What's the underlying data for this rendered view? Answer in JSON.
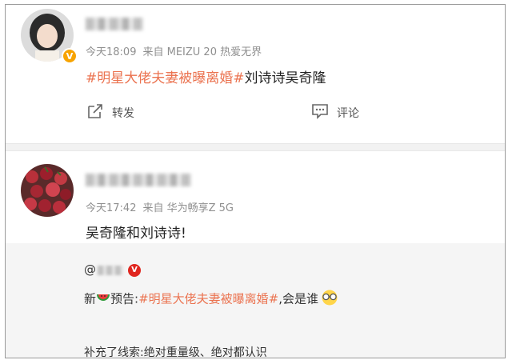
{
  "post1": {
    "time": "今天18:09",
    "source": "来自 MEIZU 20 热爱无界",
    "hashtag": "#明星大佬夫妻被曝离婚#",
    "text_after": "刘诗诗吴奇隆",
    "repost_label": "转发",
    "comment_label": "评论"
  },
  "post2": {
    "time": "今天17:42",
    "source": "来自 华为畅享Z 5G",
    "text": "吴奇隆和刘诗诗!",
    "quote": {
      "mention_prefix": "@",
      "line1_prefix": "新",
      "line1_middle": "预告:",
      "line1_hashtag": "#明星大佬夫妻被曝离婚#",
      "line1_suffix": ",会是谁",
      "line3": "补充了线索:绝对重量级、绝对都认识"
    }
  },
  "colors": {
    "hashtag": "#eb7350",
    "verified_orange": "#f7a300",
    "verified_red": "#e0261f"
  },
  "icons": {
    "repost": "repost-icon",
    "comment": "comment-icon",
    "watermelon": "watermelon-emoji",
    "glasses": "glasses-emoji"
  }
}
